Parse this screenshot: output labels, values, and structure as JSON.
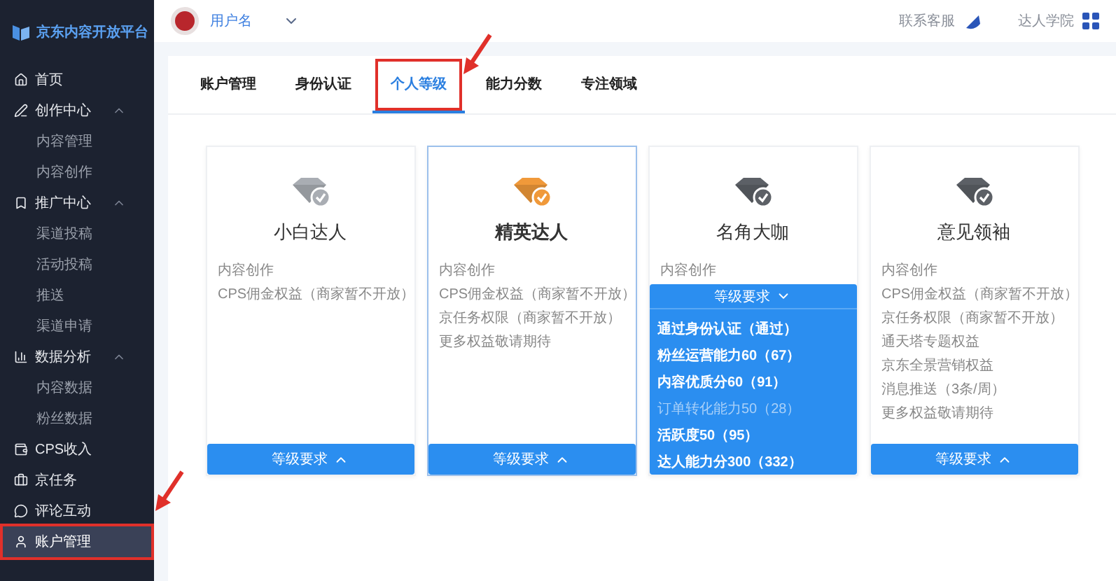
{
  "sidebar": {
    "logo": "京东内容开放平台",
    "items": [
      {
        "label": "首页",
        "kind": "link",
        "selected": false,
        "highlighted": false
      },
      {
        "label": "创作中心",
        "kind": "group",
        "expanded": true,
        "children": [
          {
            "label": "内容管理"
          },
          {
            "label": "内容创作"
          }
        ]
      },
      {
        "label": "推广中心",
        "kind": "group",
        "expanded": true,
        "children": [
          {
            "label": "渠道投稿"
          },
          {
            "label": "活动投稿"
          },
          {
            "label": "推送"
          },
          {
            "label": "渠道申请"
          }
        ]
      },
      {
        "label": "数据分析",
        "kind": "group",
        "expanded": true,
        "children": [
          {
            "label": "内容数据"
          },
          {
            "label": "粉丝数据"
          }
        ]
      },
      {
        "label": "CPS收入",
        "kind": "link",
        "selected": false,
        "highlighted": false
      },
      {
        "label": "京任务",
        "kind": "link",
        "selected": false,
        "highlighted": false
      },
      {
        "label": "评论互动",
        "kind": "link",
        "selected": false,
        "highlighted": false
      },
      {
        "label": "账户管理",
        "kind": "link",
        "selected": true,
        "highlighted": true
      }
    ]
  },
  "header": {
    "user": "用户名",
    "links": [
      "联系客服",
      "达人学院"
    ]
  },
  "tabs": [
    {
      "label": "账户管理",
      "selected": false,
      "highlighted": false
    },
    {
      "label": "身份认证",
      "selected": false,
      "highlighted": false
    },
    {
      "label": "个人等级",
      "selected": true,
      "highlighted": true
    },
    {
      "label": "能力分数",
      "selected": false,
      "highlighted": false
    },
    {
      "label": "专注领域",
      "selected": false,
      "highlighted": false
    }
  ],
  "levels": [
    {
      "title": "小白达人",
      "color": "#a9adb3",
      "selected": false,
      "expanded": false,
      "features": [
        "内容创作",
        "CPS佣金权益（商家暂不开放）"
      ],
      "button": "等级要求"
    },
    {
      "title": "精英达人",
      "color": "#f0993a",
      "selected": true,
      "expanded": false,
      "features": [
        "内容创作",
        "CPS佣金权益（商家暂不开放）",
        "京任务权限（商家暂不开放）",
        "更多权益敬请期待"
      ],
      "button": "等级要求"
    },
    {
      "title": "名角大咖",
      "color": "#5c6066",
      "selected": false,
      "expanded": true,
      "features": [
        "内容创作"
      ],
      "button": "等级要求",
      "requirements": [
        {
          "text": "通过身份认证（通过）",
          "met": true
        },
        {
          "text": "粉丝运营能力60（67）",
          "met": true
        },
        {
          "text": "内容优质分60（91）",
          "met": true
        },
        {
          "text": "订单转化能力50（28）",
          "met": false
        },
        {
          "text": "活跃度50（95）",
          "met": true
        },
        {
          "text": "达人能力分300（332）",
          "met": true
        }
      ]
    },
    {
      "title": "意见领袖",
      "color": "#5c6066",
      "selected": false,
      "expanded": false,
      "features": [
        "内容创作",
        "CPS佣金权益（商家暂不开放）",
        "京任务权限（商家暂不开放）",
        "通天塔专题权益",
        "京东全景营销权益",
        "消息推送（3条/周）",
        "更多权益敬请期待"
      ],
      "button": "等级要求"
    }
  ]
}
